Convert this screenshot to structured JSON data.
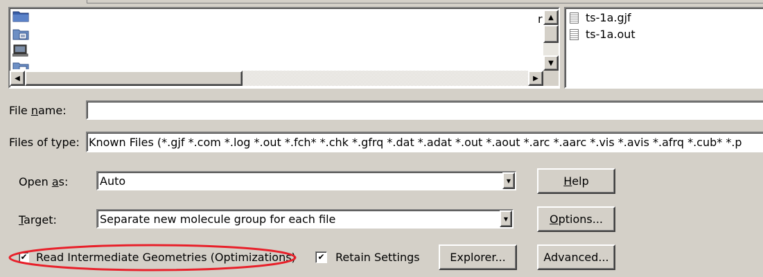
{
  "left_pane": {
    "items": [
      {
        "icon": "folder-icon"
      },
      {
        "icon": "network-folder-icon"
      },
      {
        "icon": "computer-icon"
      },
      {
        "icon": "network-folder-icon"
      }
    ],
    "clipped_text": "r"
  },
  "file_list": {
    "files": [
      {
        "name": "ts-1a.gjf",
        "icon": "document-icon"
      },
      {
        "name": "ts-1a.out",
        "icon": "document-icon"
      }
    ]
  },
  "file_name": {
    "label_prefix": "File ",
    "label_mnemonic": "n",
    "label_suffix": "ame:",
    "value": ""
  },
  "files_of_type": {
    "label": "Files of type:",
    "value": "Known Files (*.gjf *.com *.log *.out *.fch* *.chk *.gfrq *.dat *.adat *.out *.aout *.arc *.aarc *.vis *.avis *.afrq *.cub* *.p"
  },
  "open_as": {
    "label_prefix": "Open ",
    "label_mnemonic": "a",
    "label_suffix": "s:",
    "value": "Auto"
  },
  "target": {
    "label_mnemonic": "T",
    "label_suffix": "arget:",
    "value": "Separate new molecule group for each file"
  },
  "buttons": {
    "help_mnemonic": "H",
    "help_rest": "elp",
    "options_mnemonic": "O",
    "options_rest": "ptions...",
    "explorer": "Explorer...",
    "advanced": "Advanced..."
  },
  "checkboxes": {
    "read_intermediate": {
      "label": "Read Intermediate Geometries (Optimizations)",
      "checked": true,
      "mark": "✔"
    },
    "retain_settings": {
      "label": "Retain Settings",
      "checked": true,
      "mark": "✔"
    }
  },
  "colors": {
    "dialog_bg": "#d4d0c8",
    "highlight_ellipse": "#e8202a"
  }
}
